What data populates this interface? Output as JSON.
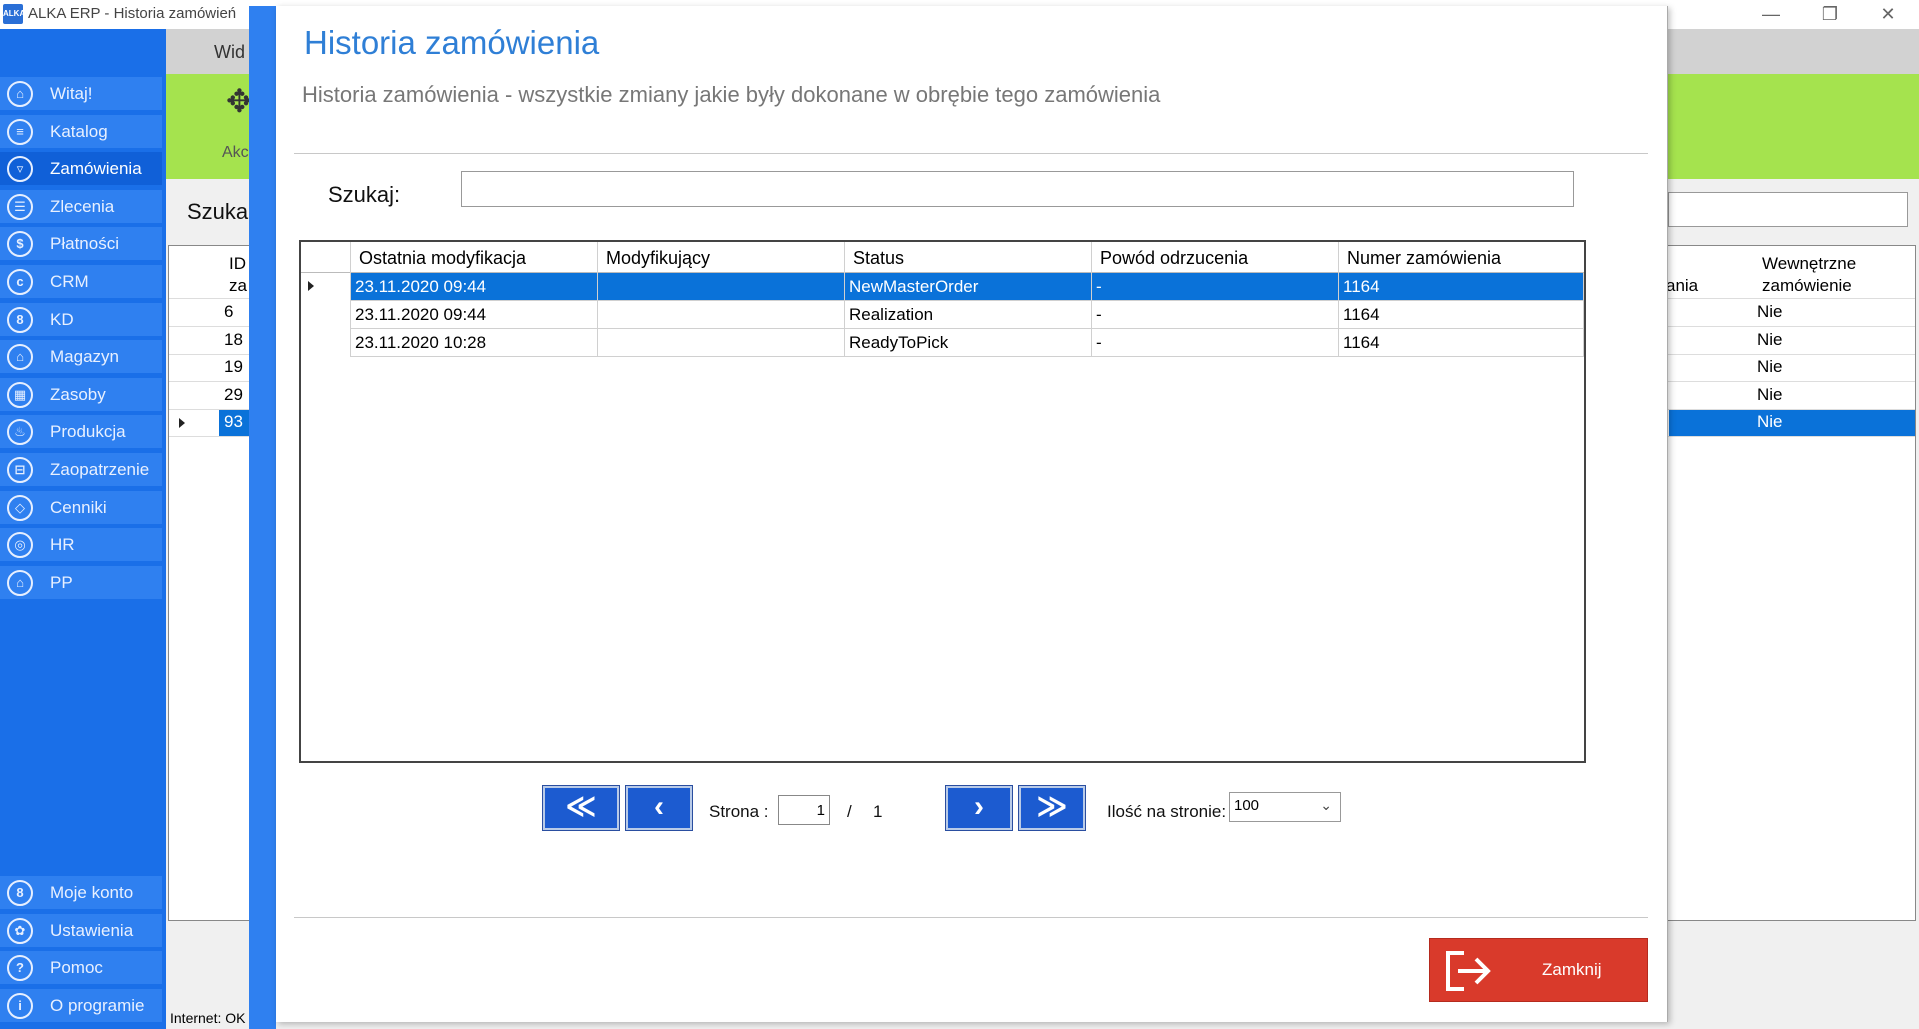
{
  "window": {
    "title": "ALKA ERP - Historia zamówień",
    "app_icon_text": "ALKA",
    "controls": [
      "—",
      "❐",
      "✕"
    ]
  },
  "sidebar": {
    "items": [
      {
        "label": "Witaj!",
        "icon": "home-icon",
        "glyph": "⌂"
      },
      {
        "label": "Katalog",
        "icon": "book-icon",
        "glyph": "≡"
      },
      {
        "label": "Zamówienia",
        "icon": "cart-icon",
        "glyph": "▿"
      },
      {
        "label": "Zlecenia",
        "icon": "list-icon",
        "glyph": "☰"
      },
      {
        "label": "Płatności",
        "icon": "dollar-icon",
        "glyph": "$"
      },
      {
        "label": "CRM",
        "icon": "crm-icon",
        "glyph": "c"
      },
      {
        "label": "KD",
        "icon": "person-icon",
        "glyph": "8"
      },
      {
        "label": "Magazyn",
        "icon": "warehouse-icon",
        "glyph": "⌂"
      },
      {
        "label": "Zasoby",
        "icon": "resources-icon",
        "glyph": "▦"
      },
      {
        "label": "Produkcja",
        "icon": "production-icon",
        "glyph": "♨"
      },
      {
        "label": "Zaopatrzenie",
        "icon": "truck-icon",
        "glyph": "⊟"
      },
      {
        "label": "Cenniki",
        "icon": "tag-icon",
        "glyph": "◇"
      },
      {
        "label": "HR",
        "icon": "hr-icon",
        "glyph": "◎"
      },
      {
        "label": "PP",
        "icon": "pp-icon",
        "glyph": "⌂"
      }
    ],
    "active_index": 2,
    "bottom_items": [
      {
        "label": "Moje konto",
        "icon": "account-icon",
        "glyph": "8"
      },
      {
        "label": "Ustawienia",
        "icon": "settings-icon",
        "glyph": "✿"
      },
      {
        "label": "Pomoc",
        "icon": "help-icon",
        "glyph": "?"
      },
      {
        "label": "O programie",
        "icon": "info-icon",
        "glyph": "i"
      }
    ]
  },
  "background": {
    "tab_label": "Wid",
    "ribbon_label": "Akc",
    "search_label": "Szuka",
    "grid_header_left": [
      "ID",
      "za"
    ],
    "grid_header_right_a": "ania",
    "grid_header_right_b": [
      "Wewnętrzne",
      "zamówienie"
    ],
    "rows": [
      {
        "id": "6",
        "internal": "Nie"
      },
      {
        "id": "18",
        "internal": "Nie"
      },
      {
        "id": "19",
        "internal": "Nie"
      },
      {
        "id": "29",
        "internal": "Nie"
      },
      {
        "id": "93",
        "internal": "Nie"
      }
    ],
    "selected_row": 4,
    "status": "Internet: OK"
  },
  "dialog": {
    "title": "Historia zamówienia",
    "subtitle": "Historia zamówienia - wszystkie zmiany jakie były dokonane w obrębie tego zamówienia",
    "search_label": "Szukaj:",
    "search_value": "",
    "columns": [
      "Ostatnia modyfikacja",
      "Modyfikujący",
      "Status",
      "Powód odrzucenia",
      "Numer zamówienia"
    ],
    "rows": [
      [
        "23.11.2020 09:44",
        "",
        "NewMasterOrder",
        "-",
        "1164"
      ],
      [
        "23.11.2020 09:44",
        "",
        "Realization",
        "-",
        "1164"
      ],
      [
        "23.11.2020 10:28",
        "",
        "ReadyToPick",
        "-",
        "1164"
      ]
    ],
    "selected_row": 0,
    "pager": {
      "first": "≪",
      "prev": "‹",
      "next": "›",
      "last": "≫",
      "page_label": "Strona :",
      "page_value": "1",
      "separator": "/",
      "total_pages": "1",
      "per_page_label": "Ilość na stronie:",
      "per_page_value": "100"
    },
    "close_label": "Zamknij"
  },
  "colors": {
    "sidebar": "#1a6fe8",
    "accent": "#2f7fd6",
    "selection": "#0a72d9",
    "ribbon": "#a5e34e",
    "close": "#d93a2b"
  }
}
